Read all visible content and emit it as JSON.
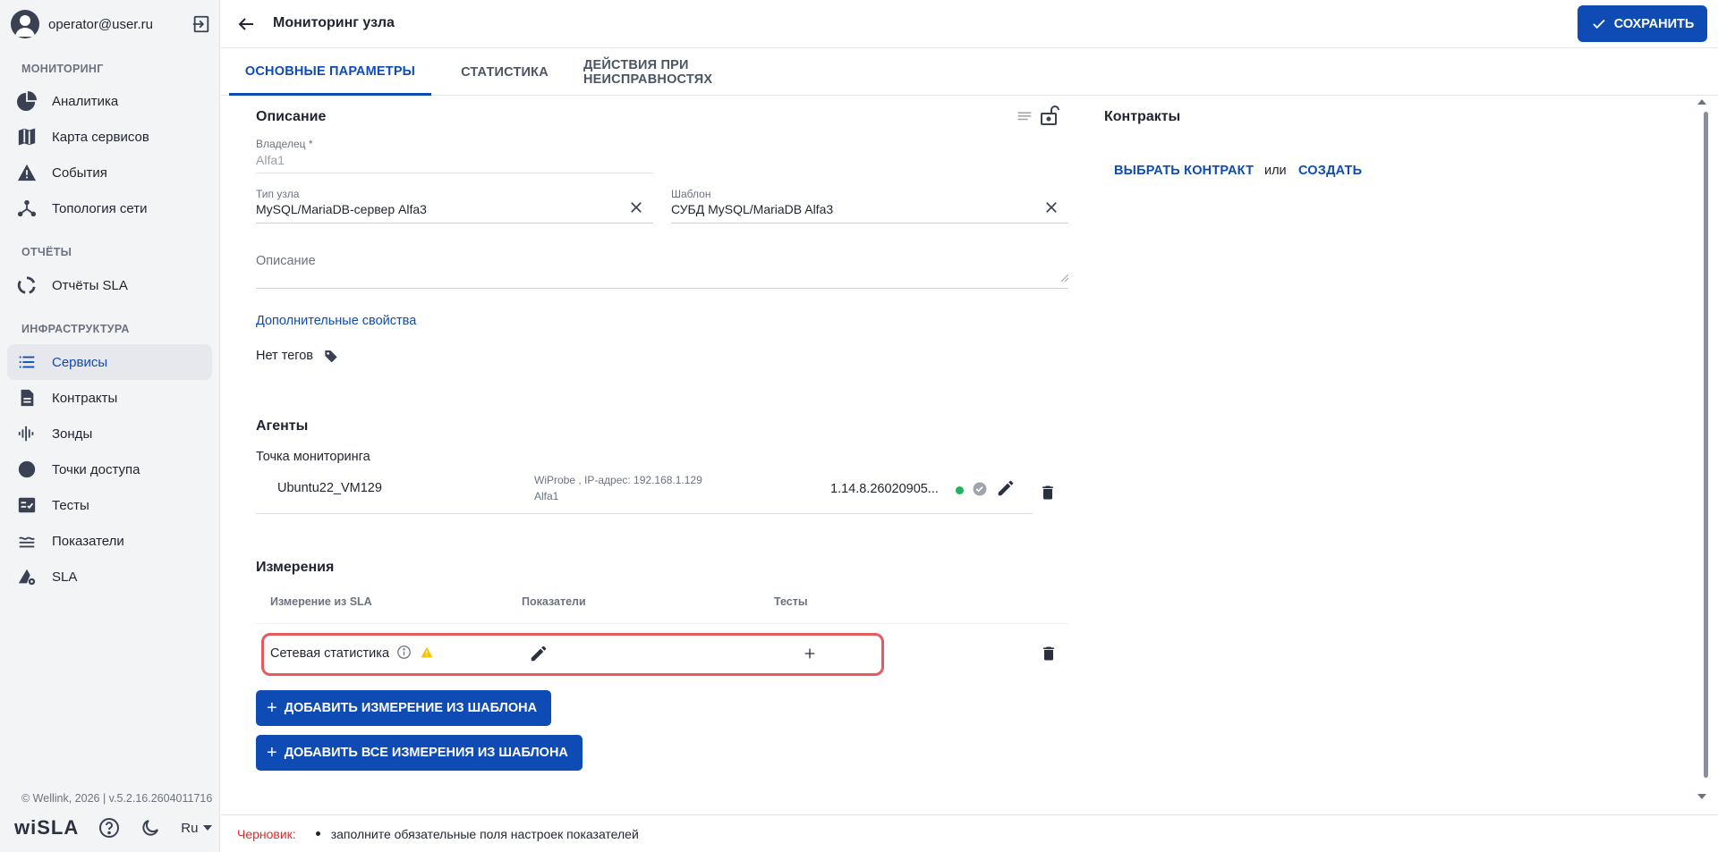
{
  "user": {
    "email": "operator@user.ru"
  },
  "sidebar": {
    "sections": {
      "monitoring": "МОНИТОРИНГ",
      "reports": "ОТЧЁТЫ",
      "infrastructure": "ИНФРАСТРУКТУРА"
    },
    "items": [
      {
        "label": "Аналитика",
        "icon": "pie-chart-icon"
      },
      {
        "label": "Карта сервисов",
        "icon": "map-icon"
      },
      {
        "label": "События",
        "icon": "warning-icon"
      },
      {
        "label": "Топология сети",
        "icon": "topology-icon"
      },
      {
        "label": "Отчёты SLA",
        "icon": "sla-report-icon"
      },
      {
        "label": "Сервисы",
        "icon": "list-icon",
        "active": true
      },
      {
        "label": "Контракты",
        "icon": "document-icon"
      },
      {
        "label": "Зонды",
        "icon": "probe-icon"
      },
      {
        "label": "Точки доступа",
        "icon": "circle-icon"
      },
      {
        "label": "Тесты",
        "icon": "tests-icon"
      },
      {
        "label": "Показатели",
        "icon": "metrics-icon"
      },
      {
        "label": "SLA",
        "icon": "sla-icon"
      }
    ],
    "copyright": "© Wellink, 2026 | v.5.2.16.2604011716",
    "logo": "wiSLA",
    "language": "Ru"
  },
  "header": {
    "title": "Мониторинг узла",
    "save_label": "СОХРАНИТЬ"
  },
  "tabs": [
    {
      "label": "ОСНОВНЫЕ ПАРАМЕТРЫ",
      "active": true
    },
    {
      "label": "СТАТИСТИКА"
    },
    {
      "label": "ДЕЙСТВИЯ ПРИ НЕИСПРАВНОСТЯХ"
    }
  ],
  "description": {
    "heading": "Описание",
    "owner_label": "Владелец *",
    "owner_value": "Alfa1",
    "node_type_label": "Тип узла",
    "node_type_value": "MySQL/MariaDB-сервер Alfa3",
    "template_label": "Шаблон",
    "template_value": "СУБД MySQL/MariaDB Alfa3",
    "description_placeholder": "Описание",
    "extra_props_link": "Дополнительные свойства",
    "no_tags": "Нет тегов"
  },
  "contracts": {
    "heading": "Контракты",
    "select_label": "ВЫБРАТЬ КОНТРАКТ",
    "or_label": "или",
    "create_label": "СОЗДАТЬ"
  },
  "agents": {
    "heading": "Агенты",
    "point_label": "Точка мониторинга",
    "name": "Ubuntu22_VM129",
    "info_line1": "WiProbe , IP-адрес: 192.168.1.129",
    "info_line2": "Alfa1",
    "version": "1.14.8.26020905..."
  },
  "measurements": {
    "heading": "Измерения",
    "columns": [
      "Измерение из SLA",
      "Показатели",
      "Тесты"
    ],
    "rows": [
      {
        "name": "Сетевая статистика"
      }
    ],
    "add_from_template": "ДОБАВИТЬ ИЗМЕРЕНИЕ ИЗ ШАБЛОНА",
    "add_all_from_template": "ДОБАВИТЬ ВСЕ ИЗМЕРЕНИЯ ИЗ ШАБЛОНА"
  },
  "footer": {
    "draft_label": "Черновик:",
    "message": "заполните обязательные поля настроек показателей"
  },
  "colors": {
    "accent": "#0e4bb5",
    "highlight": "#e55a5f",
    "draft": "#d92d2d",
    "status_ok": "#22b35e",
    "warning": "#f5c400"
  }
}
